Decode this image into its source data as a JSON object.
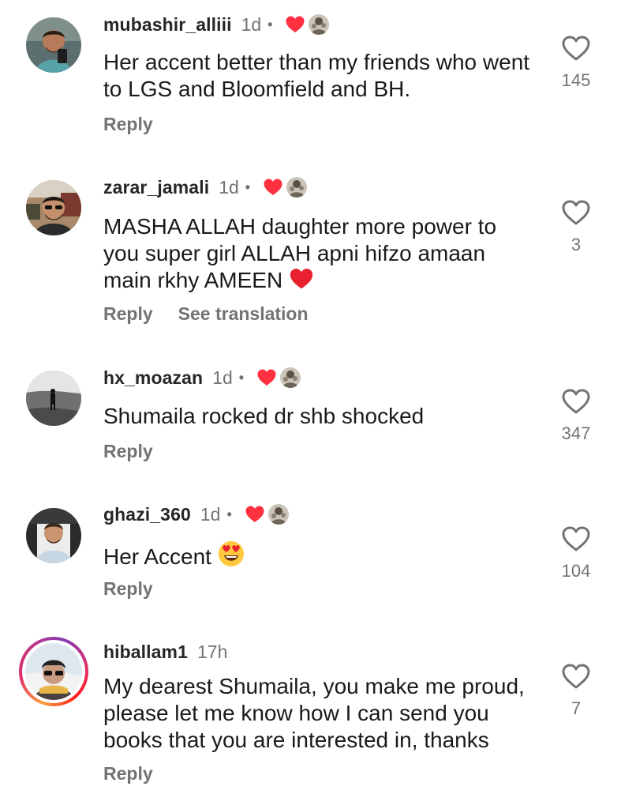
{
  "comments": [
    {
      "username": "mubashir_alliii",
      "time": "1d",
      "text": "Her accent better than my friends who went to LGS and Bloomfield and BH.",
      "reply": "Reply",
      "translation": "",
      "likes": "145",
      "creator_liked": true
    },
    {
      "username": "zarar_jamali",
      "time": "1d",
      "text": "MASHA ALLAH daughter more power to you super girl ALLAH apni hifzo amaan main rkhy AMEEN",
      "reply": "Reply",
      "translation": "See translation",
      "likes": "3",
      "creator_liked": true
    },
    {
      "username": "hx_moazan",
      "time": "1d",
      "text": "Shumaila rocked dr shb shocked",
      "reply": "Reply",
      "translation": "",
      "likes": "347",
      "creator_liked": true
    },
    {
      "username": "ghazi_360",
      "time": "1d",
      "text": "Her Accent",
      "reply": "Reply",
      "translation": "",
      "likes": "104",
      "creator_liked": true
    },
    {
      "username": "hiballam1",
      "time": "17h",
      "text": "My dearest Shumaila, you make me proud, please let me know how I can send you books that you are interested in, thanks",
      "reply": "Reply",
      "translation": "",
      "likes": "7",
      "creator_liked": false
    }
  ],
  "colors": {
    "username": "#262626",
    "secondary": "#737373",
    "liked_heart": "#ff3040",
    "story_ring": "#e1306c"
  },
  "icons": {
    "like": "heart-outline-icon",
    "creator_like": "heart-filled-icon",
    "emoji_heart": "red-heart-emoji",
    "emoji_heart_eyes": "heart-eyes-emoji"
  }
}
